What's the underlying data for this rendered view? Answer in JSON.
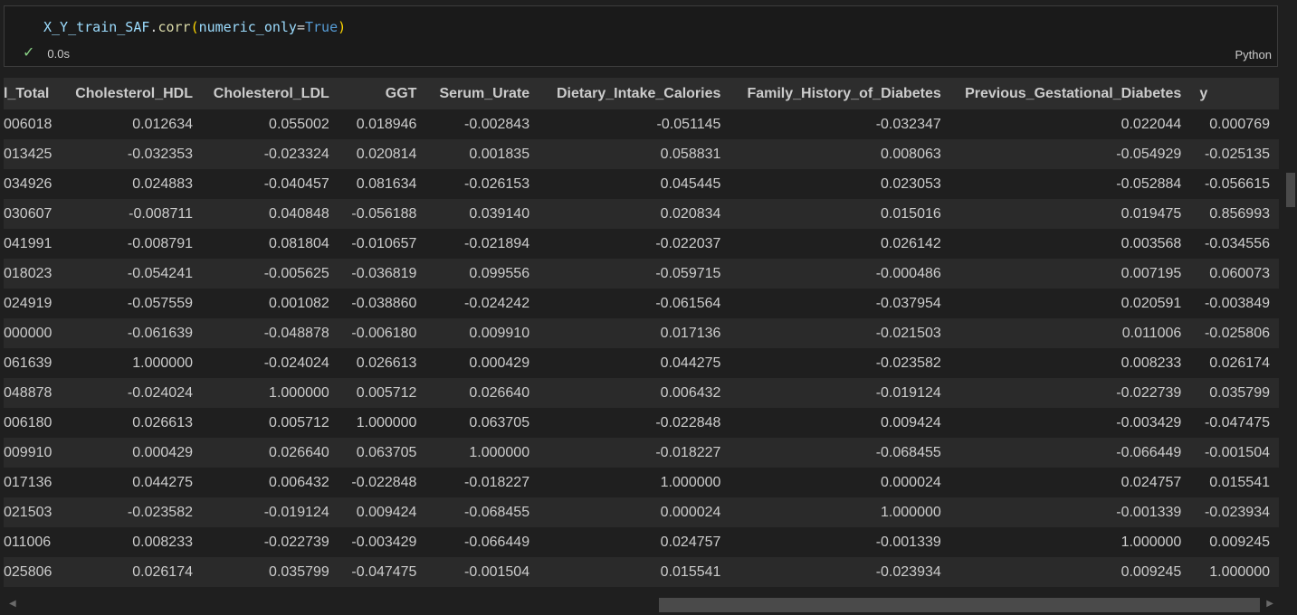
{
  "cell": {
    "code": {
      "var": "X_Y_train_SAF",
      "dot": ".",
      "fn": "corr",
      "open": "(",
      "param": "numeric_only",
      "eq": "=",
      "value": "True",
      "close": ")"
    },
    "exec_time": "0.0s",
    "language": "Python"
  },
  "table": {
    "columns": [
      "l_Total",
      "Cholesterol_HDL",
      "Cholesterol_LDL",
      "GGT",
      "Serum_Urate",
      "Dietary_Intake_Calories",
      "Family_History_of_Diabetes",
      "Previous_Gestational_Diabetes",
      "y"
    ],
    "rows": [
      [
        "006018",
        "0.012634",
        "0.055002",
        "0.018946",
        "-0.002843",
        "-0.051145",
        "-0.032347",
        "0.022044",
        "0.000769"
      ],
      [
        "013425",
        "-0.032353",
        "-0.023324",
        "0.020814",
        "0.001835",
        "0.058831",
        "0.008063",
        "-0.054929",
        "-0.025135"
      ],
      [
        "034926",
        "0.024883",
        "-0.040457",
        "0.081634",
        "-0.026153",
        "0.045445",
        "0.023053",
        "-0.052884",
        "-0.056615"
      ],
      [
        "030607",
        "-0.008711",
        "0.040848",
        "-0.056188",
        "0.039140",
        "0.020834",
        "0.015016",
        "0.019475",
        "0.856993"
      ],
      [
        "041991",
        "-0.008791",
        "0.081804",
        "-0.010657",
        "-0.021894",
        "-0.022037",
        "0.026142",
        "0.003568",
        "-0.034556"
      ],
      [
        "018023",
        "-0.054241",
        "-0.005625",
        "-0.036819",
        "0.099556",
        "-0.059715",
        "-0.000486",
        "0.007195",
        "0.060073"
      ],
      [
        "024919",
        "-0.057559",
        "0.001082",
        "-0.038860",
        "-0.024242",
        "-0.061564",
        "-0.037954",
        "0.020591",
        "-0.003849"
      ],
      [
        "000000",
        "-0.061639",
        "-0.048878",
        "-0.006180",
        "0.009910",
        "0.017136",
        "-0.021503",
        "0.011006",
        "-0.025806"
      ],
      [
        "061639",
        "1.000000",
        "-0.024024",
        "0.026613",
        "0.000429",
        "0.044275",
        "-0.023582",
        "0.008233",
        "0.026174"
      ],
      [
        "048878",
        "-0.024024",
        "1.000000",
        "0.005712",
        "0.026640",
        "0.006432",
        "-0.019124",
        "-0.022739",
        "0.035799"
      ],
      [
        "006180",
        "0.026613",
        "0.005712",
        "1.000000",
        "0.063705",
        "-0.022848",
        "0.009424",
        "-0.003429",
        "-0.047475"
      ],
      [
        "009910",
        "0.000429",
        "0.026640",
        "0.063705",
        "1.000000",
        "-0.018227",
        "-0.068455",
        "-0.066449",
        "-0.001504"
      ],
      [
        "017136",
        "0.044275",
        "0.006432",
        "-0.022848",
        "-0.018227",
        "1.000000",
        "0.000024",
        "0.024757",
        "0.015541"
      ],
      [
        "021503",
        "-0.023582",
        "-0.019124",
        "0.009424",
        "-0.068455",
        "0.000024",
        "1.000000",
        "-0.001339",
        "-0.023934"
      ],
      [
        "011006",
        "0.008233",
        "-0.022739",
        "-0.003429",
        "-0.066449",
        "0.024757",
        "-0.001339",
        "1.000000",
        "0.009245"
      ],
      [
        "025806",
        "0.026174",
        "0.035799",
        "-0.047475",
        "-0.001504",
        "0.015541",
        "-0.023934",
        "0.009245",
        "1.000000"
      ]
    ]
  }
}
